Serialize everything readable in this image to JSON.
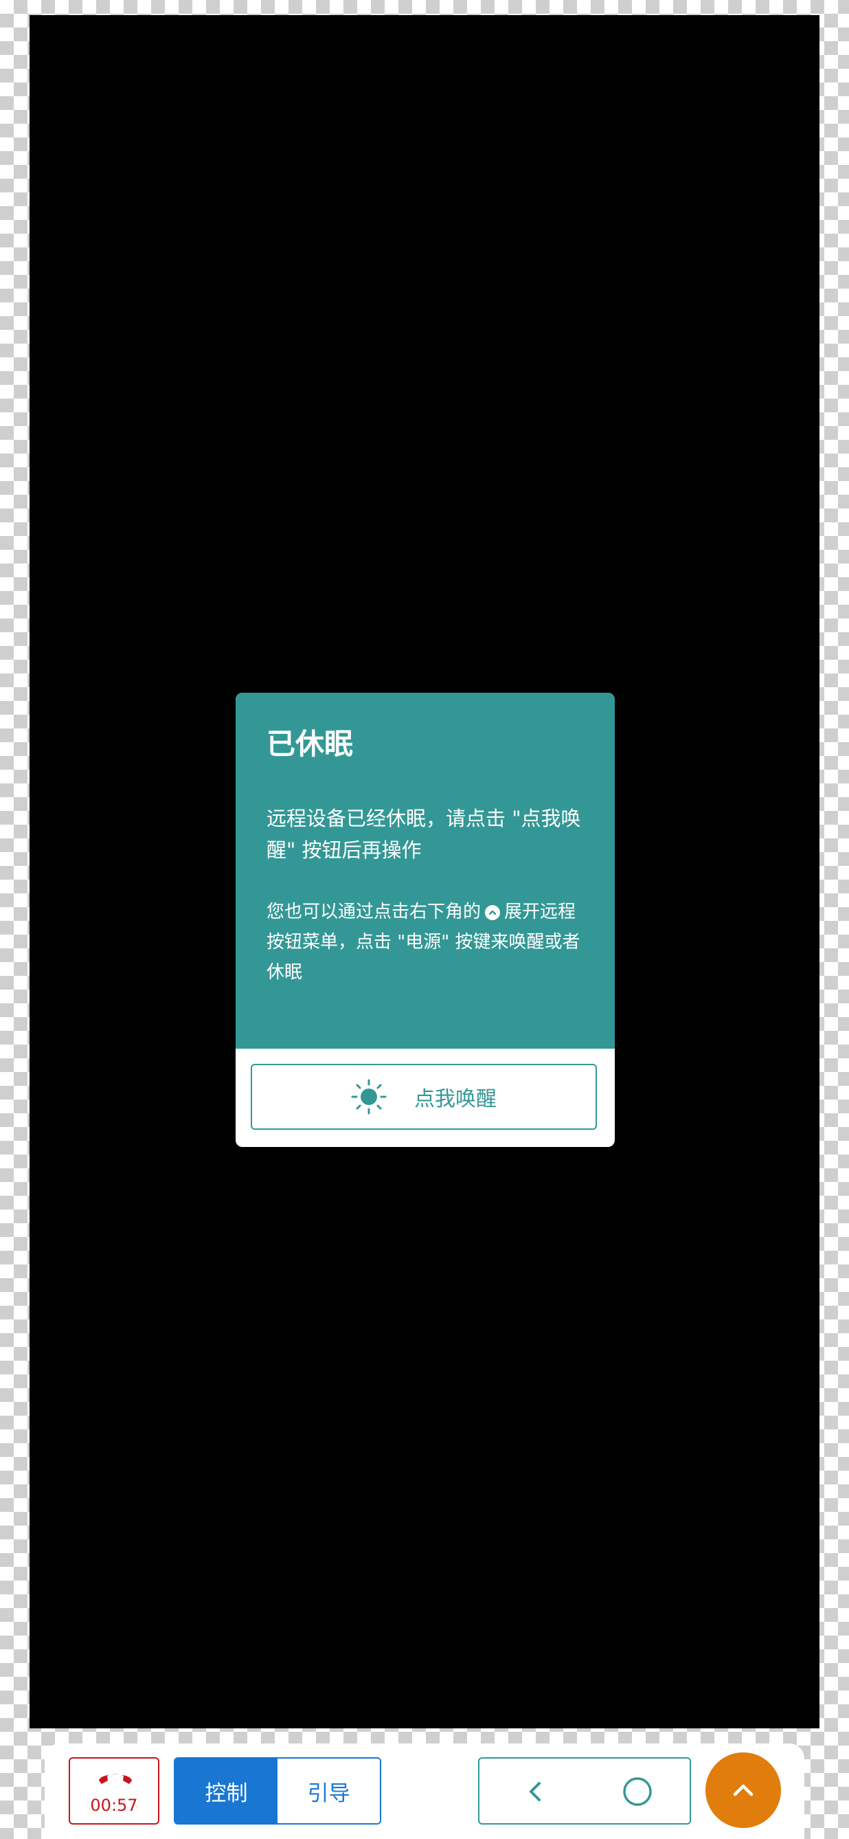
{
  "dialog": {
    "title": "已休眠",
    "message": "远程设备已经休眠，请点击 \"点我唤醒\" 按钮后再操作",
    "hint_before": "您也可以通过点击右下角的",
    "hint_after": "展开远程按钮菜单，点击 \"电源\" 按键来唤醒或者休眠",
    "wake_button_label": "点我唤醒",
    "accent_color": "#339895"
  },
  "toolbar": {
    "call_timer": "00:57",
    "tabs": [
      {
        "label": "控制",
        "active": true
      },
      {
        "label": "引导",
        "active": false
      }
    ],
    "nav_buttons": [
      "back-icon",
      "home-icon"
    ],
    "expand_button_icon": "chevron-up-icon",
    "colors": {
      "hangup": "#c6161c",
      "mode": "#1976d2",
      "nav": "#339895",
      "fab": "#e07d0c"
    }
  }
}
